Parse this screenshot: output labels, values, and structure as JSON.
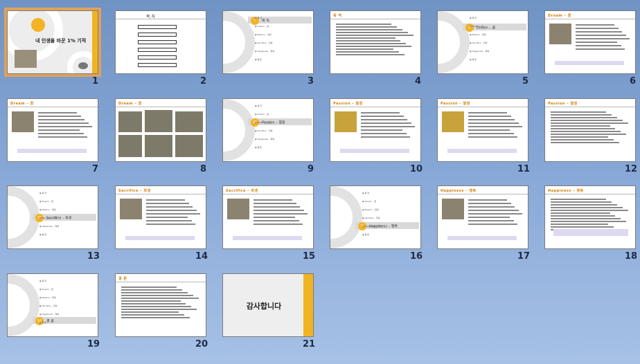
{
  "slides": [
    {
      "number": "1",
      "kind": "title",
      "title": "내 인생을 바꾼 1% 기적",
      "selected": true
    },
    {
      "number": "2",
      "kind": "toc",
      "title": "목 차"
    },
    {
      "number": "3",
      "kind": "section",
      "roman": "I",
      "label": "목 적"
    },
    {
      "number": "4",
      "kind": "text",
      "header": "목 적"
    },
    {
      "number": "5",
      "kind": "section",
      "roman": "II",
      "label": "Dream – 꿈"
    },
    {
      "number": "6",
      "kind": "photo-text",
      "header": "Dream – 꿈"
    },
    {
      "number": "7",
      "kind": "photo-text",
      "header": "Dream – 꿈"
    },
    {
      "number": "8",
      "kind": "gallery",
      "header": "Dream – 꿈"
    },
    {
      "number": "9",
      "kind": "section",
      "roman": "III",
      "label": "Passion – 열정"
    },
    {
      "number": "10",
      "kind": "photo-text",
      "header": "Passion – 열정"
    },
    {
      "number": "11",
      "kind": "photo-text",
      "header": "Passion – 열정"
    },
    {
      "number": "12",
      "kind": "text",
      "header": "Passion – 열정"
    },
    {
      "number": "13",
      "kind": "section",
      "roman": "IV",
      "label": "Sacrifice – 희생"
    },
    {
      "number": "14",
      "kind": "photo-text",
      "header": "Sacrifice – 희생"
    },
    {
      "number": "15",
      "kind": "photo-text",
      "header": "Sacrifice – 희생"
    },
    {
      "number": "16",
      "kind": "section",
      "roman": "V",
      "label": "Happiness – 행복"
    },
    {
      "number": "17",
      "kind": "photo-text",
      "header": "Happiness – 행복"
    },
    {
      "number": "18",
      "kind": "text",
      "header": "Happiness – 행복"
    },
    {
      "number": "19",
      "kind": "section",
      "roman": "VI",
      "label": "결 론"
    },
    {
      "number": "20",
      "kind": "text",
      "header": "결 론"
    },
    {
      "number": "21",
      "kind": "thanks",
      "label": "감사합니다"
    }
  ],
  "section_bullets": [
    "● 목 적",
    "● Dream – 꿈",
    "● Passion – 열정",
    "● Sacrifice – 희생",
    "● Happiness – 행복",
    "● 결 론"
  ],
  "colors": {
    "accent": "#f0b423",
    "selection": "#e0a15a",
    "background": "#7d9ccc"
  }
}
